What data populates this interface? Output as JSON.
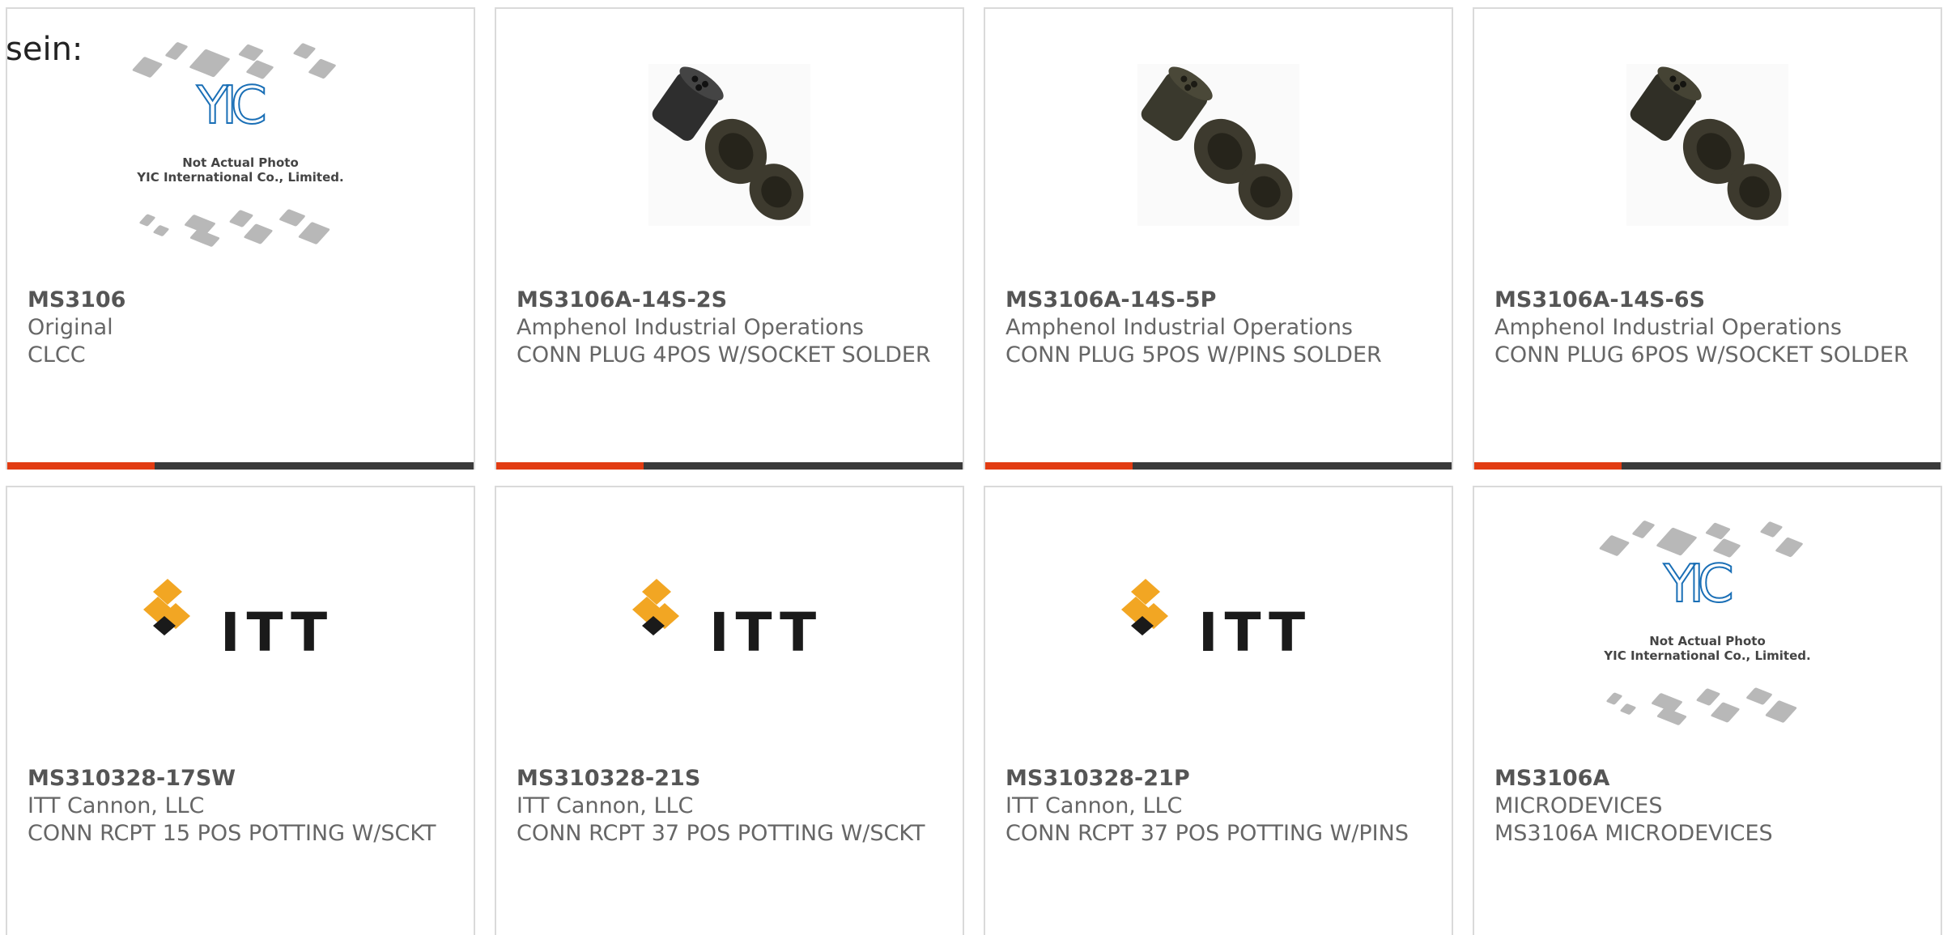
{
  "intro_text": "sein:",
  "colors": {
    "accent": "#e23c12",
    "bar": "#3a3a3a",
    "card_border": "#dadada",
    "text": "#666666"
  },
  "products": [
    {
      "part_number": "MS3106",
      "manufacturer": "Original",
      "description": "CLCC",
      "image_type": "yic-placeholder-icon",
      "image_caption_1": "Not Actual Photo",
      "image_caption_2": "YIC International Co., Limited."
    },
    {
      "part_number": "MS3106A-14S-2S",
      "manufacturer": "Amphenol Industrial Operations",
      "description": "CONN PLUG 4POS W/SOCKET SOLDER",
      "image_type": "connector-photo-icon"
    },
    {
      "part_number": "MS3106A-14S-5P",
      "manufacturer": "Amphenol Industrial Operations",
      "description": "CONN PLUG 5POS W/PINS SOLDER",
      "image_type": "connector-photo-icon"
    },
    {
      "part_number": "MS3106A-14S-6S",
      "manufacturer": "Amphenol Industrial Operations",
      "description": "CONN PLUG 6POS W/SOCKET SOLDER",
      "image_type": "connector-photo-icon"
    },
    {
      "part_number": "MS310328-17SW",
      "manufacturer": "ITT Cannon, LLC",
      "description": "CONN RCPT 15 POS POTTING W/SCKT",
      "image_type": "itt-logo-icon",
      "logo_text": "ITT"
    },
    {
      "part_number": "MS310328-21S",
      "manufacturer": "ITT Cannon, LLC",
      "description": "CONN RCPT 37 POS POTTING W/SCKT",
      "image_type": "itt-logo-icon",
      "logo_text": "ITT"
    },
    {
      "part_number": "MS310328-21P",
      "manufacturer": "ITT Cannon, LLC",
      "description": "CONN RCPT 37 POS POTTING W/PINS",
      "image_type": "itt-logo-icon",
      "logo_text": "ITT"
    },
    {
      "part_number": "MS3106A",
      "manufacturer": "MICRODEVICES",
      "description": "MS3106A MICRODEVICES",
      "image_type": "yic-placeholder-icon",
      "image_caption_1": "Not Actual Photo",
      "image_caption_2": "YIC International Co., Limited."
    }
  ]
}
